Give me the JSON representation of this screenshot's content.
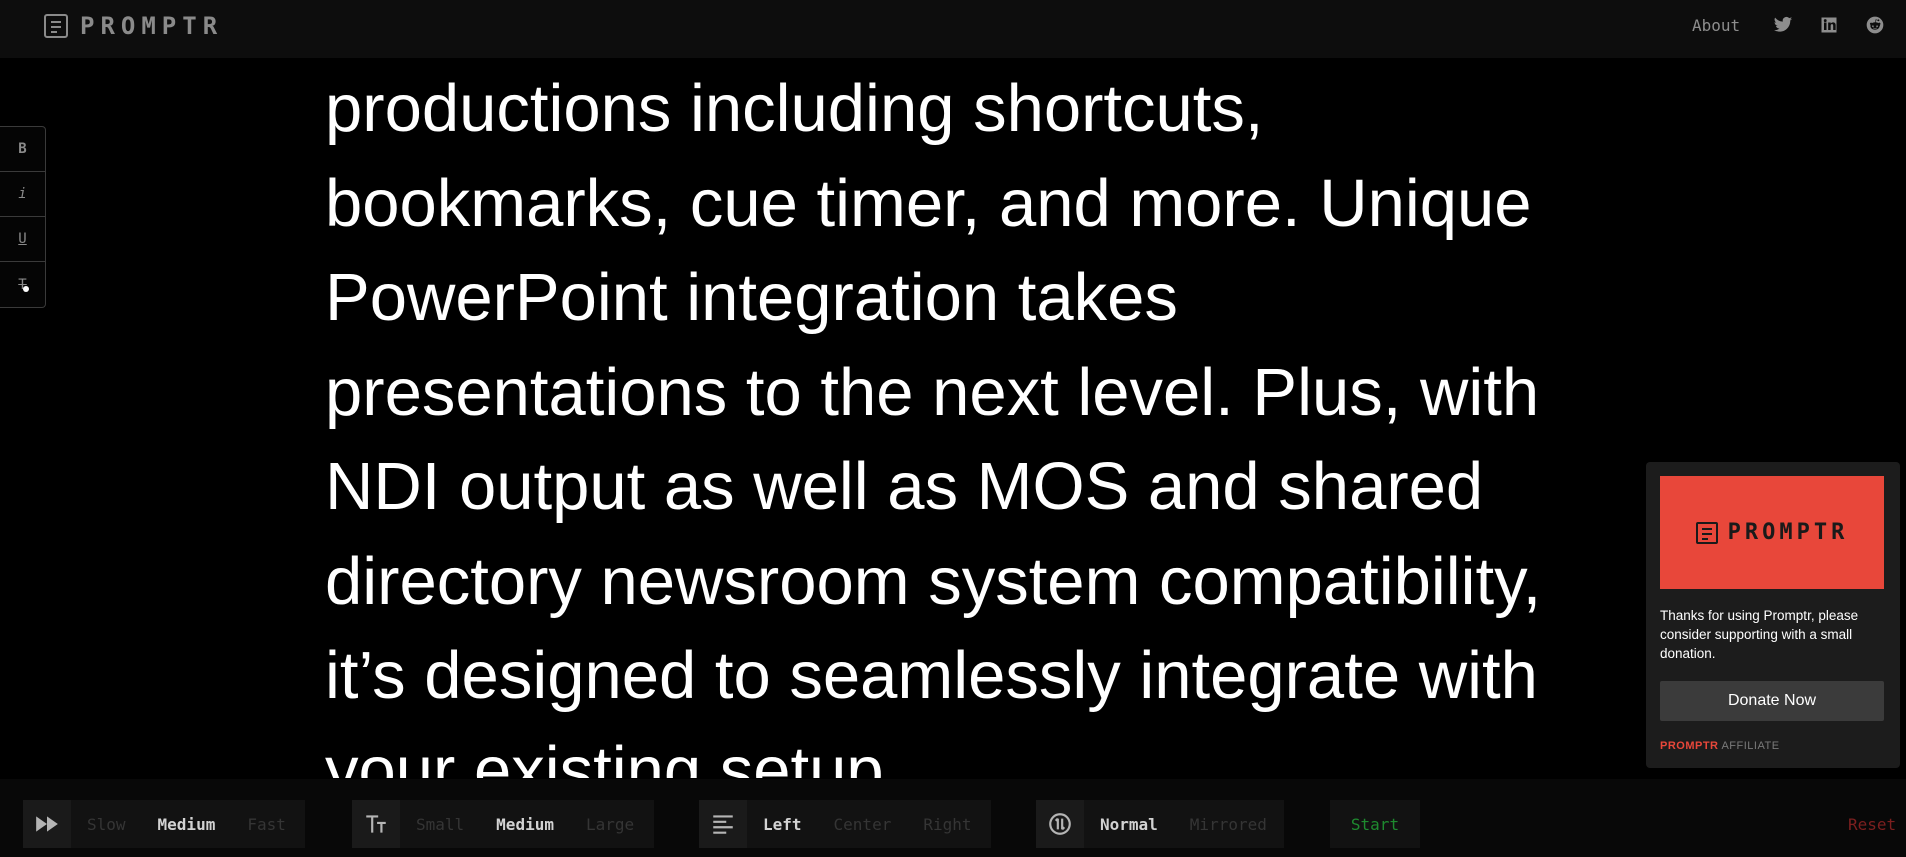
{
  "header": {
    "brand": "PROMPTR",
    "about_label": "About",
    "social": [
      "twitter-icon",
      "linkedin-icon",
      "reddit-icon"
    ]
  },
  "format_toolbar": {
    "bold": "B",
    "italic": "i",
    "underline": "U",
    "strike": "T"
  },
  "script": {
    "text": "productions including shortcuts, bookmarks, cue timer, and more. Unique PowerPoint integration takes presentations to the next level. Plus, with NDI output as well as MOS and shared directory newsroom system compatibility, it’s designed to seamlessly integrate with your existing setup."
  },
  "controls": {
    "speed": {
      "icon": "fast-forward-icon",
      "options": [
        "Slow",
        "Medium",
        "Fast"
      ],
      "selected": "Medium"
    },
    "size": {
      "icon": "text-size-icon",
      "options": [
        "Small",
        "Medium",
        "Large"
      ],
      "selected": "Medium"
    },
    "align": {
      "icon": "align-left-icon",
      "options": [
        "Left",
        "Center",
        "Right"
      ],
      "selected": "Left"
    },
    "mirror": {
      "icon": "mirror-icon",
      "options": [
        "Normal",
        "Mirrored"
      ],
      "selected": "Normal"
    },
    "start_label": "Start",
    "reset_label": "Reset"
  },
  "donation": {
    "logo_text": "PROMPTR",
    "message": "Thanks for using Promptr, please consider supporting with a small donation.",
    "button_label": "Donate Now",
    "affiliate_brand": "PROMPTR",
    "affiliate_label": "AFFILIATE"
  },
  "colors": {
    "accent": "#e8473a",
    "start": "#1e8a2f",
    "reset": "#7c1f1f",
    "background": "#000000"
  }
}
